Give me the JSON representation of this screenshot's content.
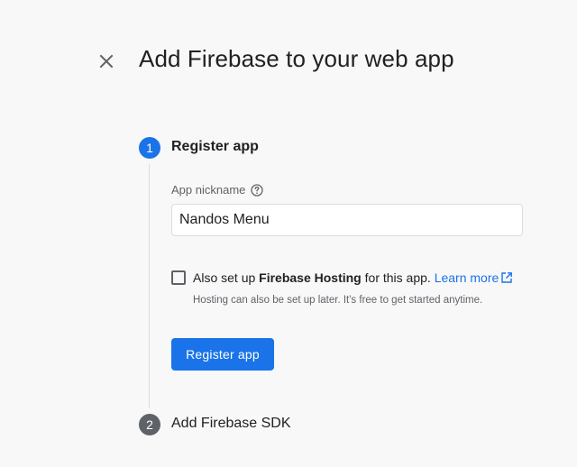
{
  "header": {
    "title": "Add Firebase to your web app",
    "close_icon": "close-icon"
  },
  "steps": [
    {
      "number": "1",
      "title": "Register app",
      "state": "active",
      "color": "#1a73e8"
    },
    {
      "number": "2",
      "title": "Add Firebase SDK",
      "state": "inactive",
      "color": "#5f6368"
    }
  ],
  "form": {
    "nickname_label": "App nickname",
    "nickname_help_icon": "help-circle-icon",
    "nickname_value": "Nandos Menu",
    "nickname_placeholder": "",
    "hosting": {
      "checked": false,
      "text_before": "Also set up ",
      "text_bold": "Firebase Hosting",
      "text_after": " for this app.",
      "link_label": "Learn more",
      "link_icon": "open-in-new-icon",
      "hint": "Hosting can also be set up later. It's free to get started anytime."
    },
    "submit_label": "Register app"
  },
  "colors": {
    "accent": "#1a73e8",
    "text": "#202124",
    "muted": "#5f6368",
    "background": "#f8f8f8"
  }
}
